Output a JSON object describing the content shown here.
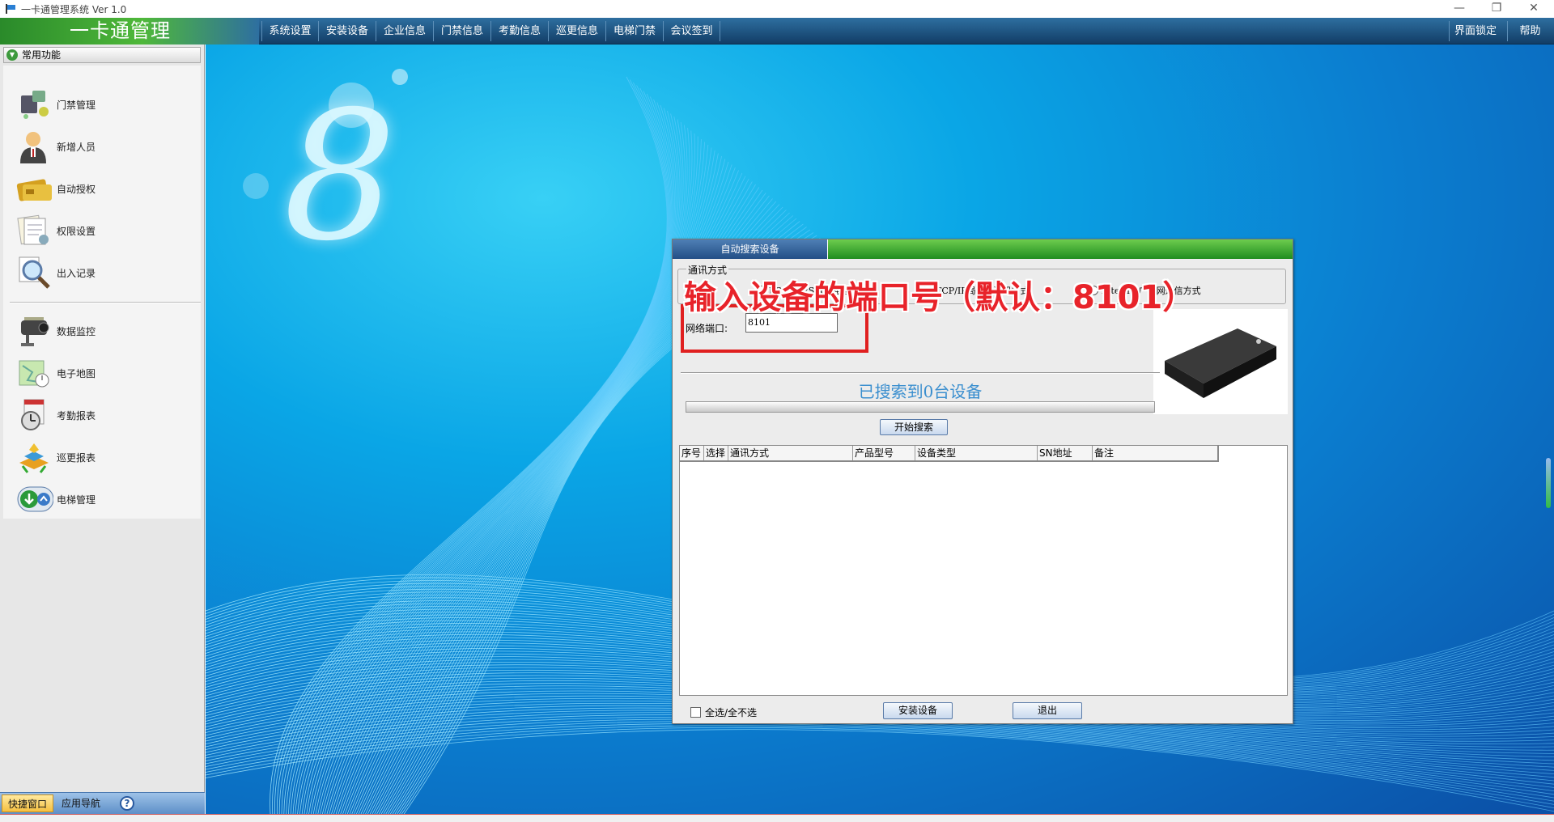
{
  "window": {
    "title": "一卡通管理系统  Ver 1.0",
    "minimize": "—",
    "restore": "❐",
    "close": "✕"
  },
  "logo": "一卡通管理",
  "menu": [
    "系统设置",
    "安装设备",
    "企业信息",
    "门禁信息",
    "考勤信息",
    "巡更信息",
    "电梯门禁",
    "会议签到"
  ],
  "menu_right": [
    "界面锁定",
    "帮助"
  ],
  "sidebar": {
    "header": "常用功能",
    "items": [
      {
        "label": "门禁管理",
        "icon": "door-controller-icon"
      },
      {
        "label": "新增人员",
        "icon": "person-icon"
      },
      {
        "label": "自动授权",
        "icon": "card-icon"
      },
      {
        "label": "权限设置",
        "icon": "document-icon"
      },
      {
        "label": "出入记录",
        "icon": "magnifier-icon"
      },
      {
        "label": "数据监控",
        "icon": "camera-icon"
      },
      {
        "label": "电子地图",
        "icon": "map-icon"
      },
      {
        "label": "考勤报表",
        "icon": "clock-icon"
      },
      {
        "label": "巡更报表",
        "icon": "patrol-icon"
      },
      {
        "label": "电梯管理",
        "icon": "elevator-icon"
      }
    ],
    "tabs": [
      "快捷窗口",
      "应用导航"
    ],
    "help_glyph": "?"
  },
  "desktop": {
    "big_numeral": "8"
  },
  "dialog": {
    "title": "自动搜索设备",
    "comm_group": "通讯方式",
    "radios": [
      {
        "label": "RS232/RS485通信方式",
        "selected": false
      },
      {
        "label": "TCP/IP局域网通讯方式",
        "selected": true
      },
      {
        "label": "Internet广域网通信方式",
        "selected": false
      }
    ],
    "port_label": "网络端口:",
    "port_value": "8101",
    "found_text": "已搜索到0台设备",
    "search_button": "开始搜索",
    "columns": [
      "序号",
      "选择",
      "通讯方式",
      "产品型号",
      "设备类型",
      "SN地址",
      "备注"
    ],
    "rows": [],
    "select_all": "全选/全不选",
    "install_button": "安装设备",
    "exit_button": "退出"
  },
  "annotation": "输入设备的端口号（默认：8101）",
  "colors": {
    "accent_blue": "#2e6fa0",
    "logo_green": "#4fb83a",
    "annotation_red": "#e8232a",
    "found_text": "#3b8fcf"
  }
}
